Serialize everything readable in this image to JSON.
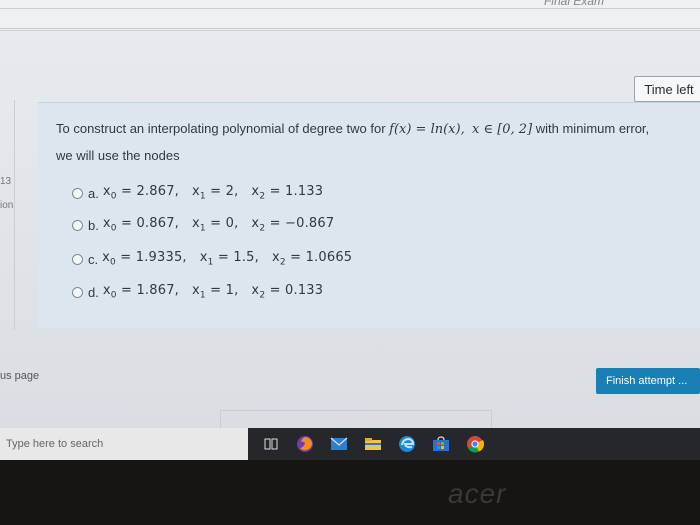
{
  "header": {
    "time_left_label": "Time left",
    "top_right_partial": "Final Exam"
  },
  "question": {
    "number_partial": "13",
    "info_partial": "ion",
    "text_line1_pre": "To construct an interpolating polynomial of degree two for ",
    "function_expr": "f(x) = ln(x),",
    "domain_expr": "x ∈ [0, 2]",
    "text_line1_post": " with minimum error,",
    "text_line2": "we will use the nodes"
  },
  "answers": [
    {
      "label": "a.",
      "x0": "2.867",
      "x1": "2",
      "x2": "1.133",
      "selected": false
    },
    {
      "label": "b.",
      "x0": "0.867",
      "x1": "0",
      "x2": "−0.867",
      "selected": false
    },
    {
      "label": "c.",
      "x0": "1.9335",
      "x1": "1.5",
      "x2": "1.0665",
      "selected": false
    },
    {
      "label": "d.",
      "x0": "1.867",
      "x1": "1",
      "x2": "0.133",
      "selected": false
    }
  ],
  "navigation": {
    "previous_page_partial": "us page",
    "finish_attempt_label": "Finish attempt ..."
  },
  "taskbar": {
    "search_placeholder": "Type here to search",
    "icons": [
      "task-view-icon",
      "firefox-icon",
      "mail-icon",
      "file-explorer-icon",
      "edge-icon",
      "store-icon",
      "chrome-icon"
    ]
  },
  "device": {
    "brand": "acer"
  },
  "colors": {
    "finish_button": "#1a7fb5",
    "question_background": "#dde6ee",
    "taskbar": "#26272b"
  }
}
